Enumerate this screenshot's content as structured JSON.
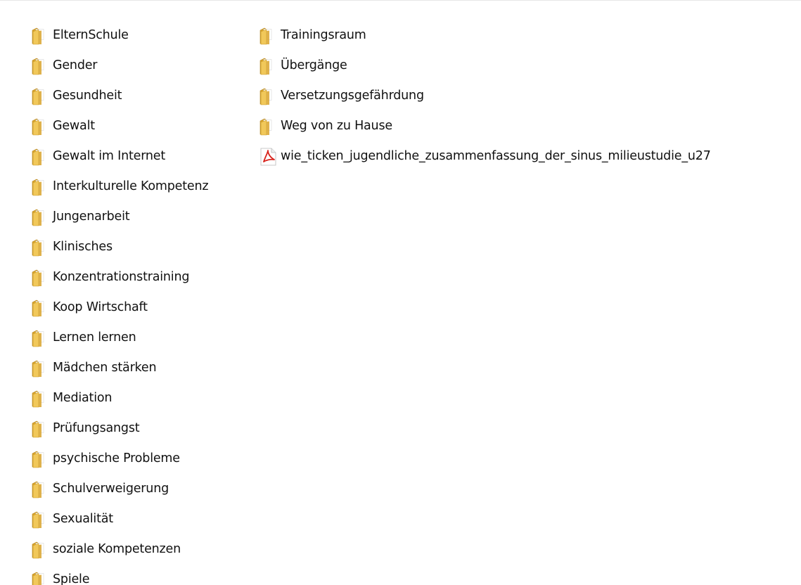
{
  "column_left": [
    {
      "name": "ElternSchule",
      "icon": "folder-icon"
    },
    {
      "name": "Gender",
      "icon": "folder-icon"
    },
    {
      "name": "Gesundheit",
      "icon": "folder-icon"
    },
    {
      "name": "Gewalt",
      "icon": "folder-icon"
    },
    {
      "name": "Gewalt im Internet",
      "icon": "folder-icon"
    },
    {
      "name": "Interkulturelle Kompetenz",
      "icon": "folder-icon"
    },
    {
      "name": "Jungenarbeit",
      "icon": "folder-icon"
    },
    {
      "name": "Klinisches",
      "icon": "folder-icon"
    },
    {
      "name": "Konzentrationstraining",
      "icon": "folder-icon"
    },
    {
      "name": "Koop Wirtschaft",
      "icon": "folder-icon"
    },
    {
      "name": "Lernen lernen",
      "icon": "folder-icon"
    },
    {
      "name": "Mädchen stärken",
      "icon": "folder-icon"
    },
    {
      "name": "Mediation",
      "icon": "folder-icon"
    },
    {
      "name": "Prüfungsangst",
      "icon": "folder-icon"
    },
    {
      "name": "psychische Probleme",
      "icon": "folder-icon"
    },
    {
      "name": "Schulverweigerung",
      "icon": "folder-icon"
    },
    {
      "name": "Sexualität",
      "icon": "folder-icon"
    },
    {
      "name": "soziale Kompetenzen",
      "icon": "folder-icon"
    },
    {
      "name": "Spiele",
      "icon": "folder-icon"
    }
  ],
  "column_right": [
    {
      "name": "Trainingsraum",
      "icon": "folder-icon"
    },
    {
      "name": "Übergänge",
      "icon": "folder-icon"
    },
    {
      "name": "Versetzungsgefährdung",
      "icon": "folder-icon"
    },
    {
      "name": "Weg von zu Hause",
      "icon": "folder-icon"
    },
    {
      "name": "wie_ticken_jugendliche_zusammenfassung_der_sinus_milieustudie_u27",
      "icon": "pdf-icon"
    }
  ],
  "colors": {
    "folder_front": "#f1c85a",
    "folder_back": "#d9a52e",
    "folder_page": "#ffffff",
    "pdf_red": "#d8231c",
    "text": "#111111",
    "background": "#ffffff"
  }
}
